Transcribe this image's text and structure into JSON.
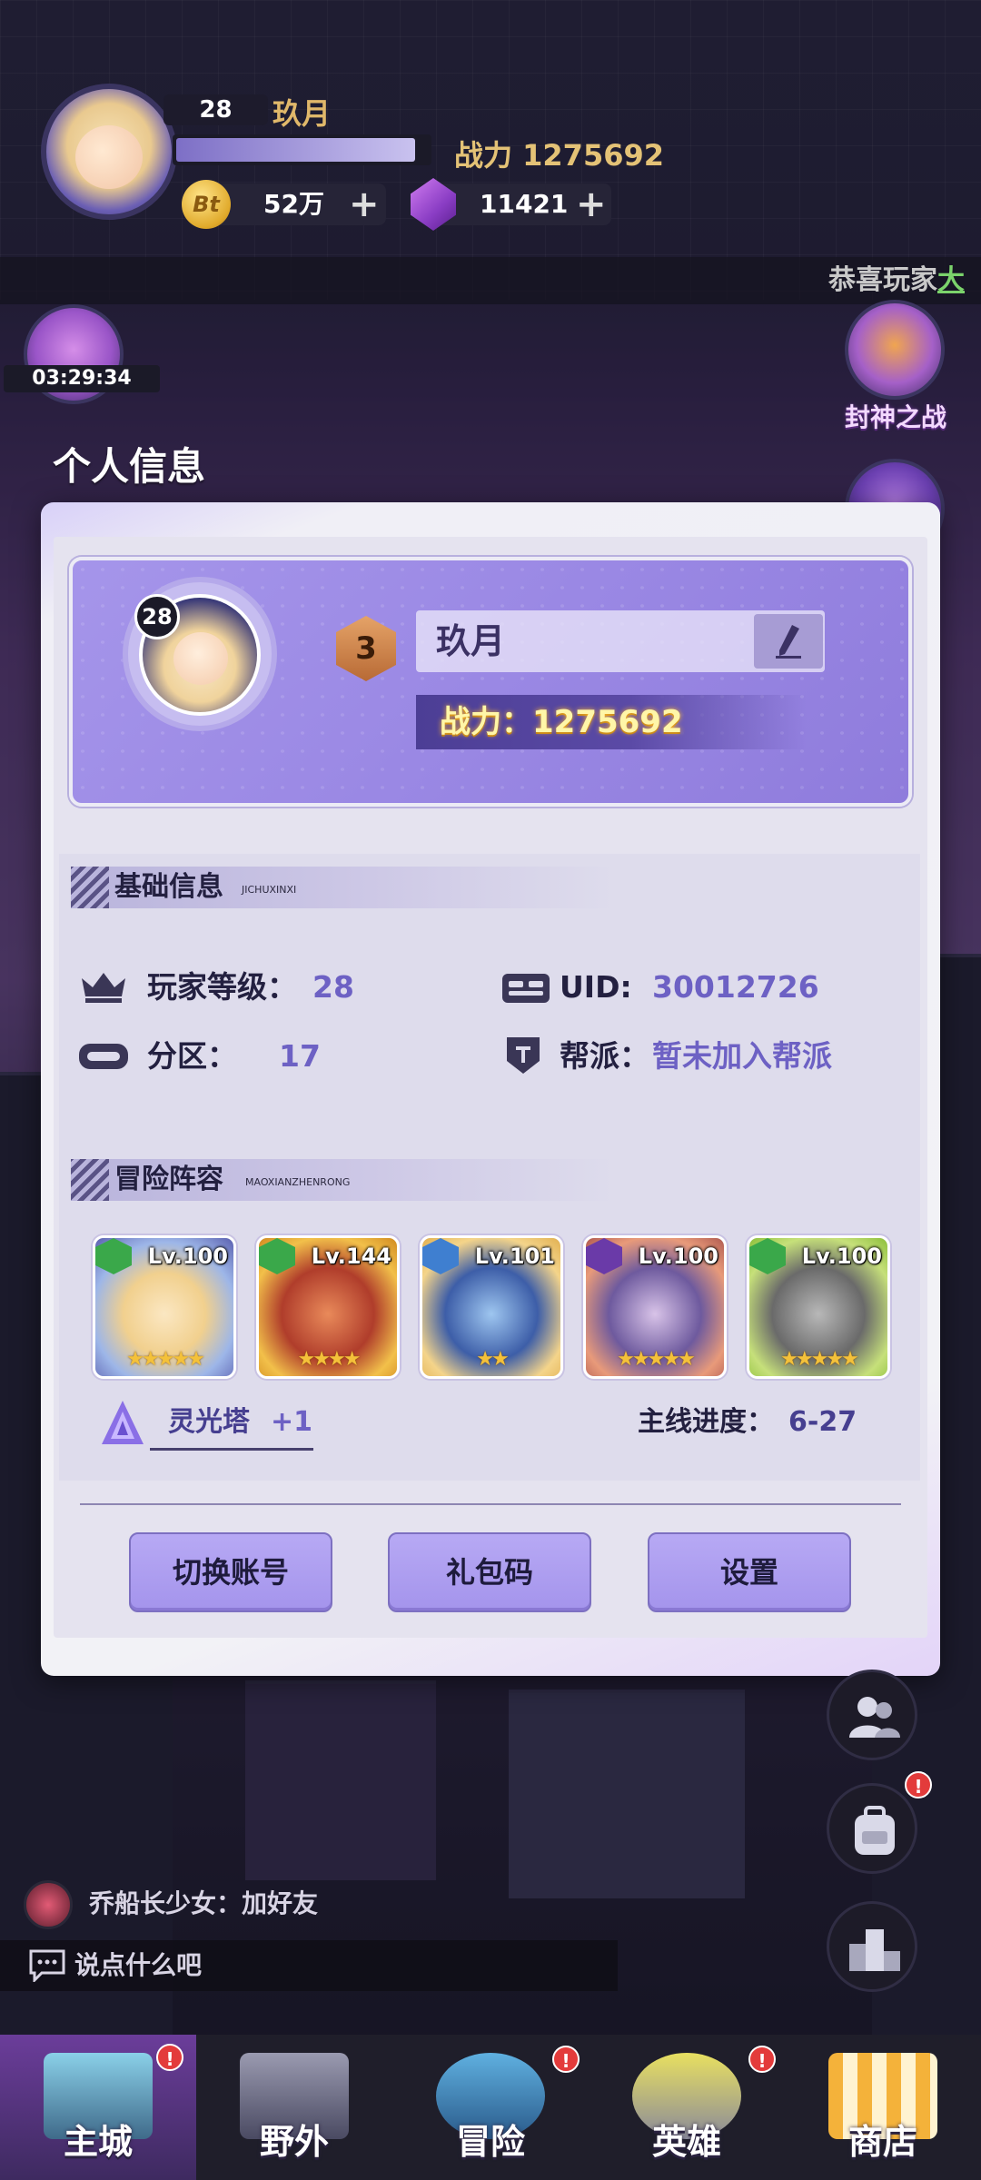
{
  "hud": {
    "level": "28",
    "name": "玖月",
    "exp_fraction": 0.95,
    "power_label": "战力 1275692",
    "coins": "52万",
    "coin_symbol": "Bt",
    "gems": "11421",
    "plus": "+",
    "ticker_prefix": "恭喜玩家",
    "ticker_highlight": "大",
    "timer": "03:29:34",
    "event_label": "封神之战"
  },
  "modal": {
    "title": "个人信息",
    "profile": {
      "level": "28",
      "vip_rank": "3",
      "name": "玖月",
      "power": "战力：1275692"
    },
    "basic_section": {
      "title": "基础信息",
      "subtitle": "JICHUXINXI",
      "player_level_label": "玩家等级：",
      "player_level_value": "28",
      "uid_label": "UID:",
      "uid_value": "30012726",
      "zone_label": "分区：",
      "zone_value": "17",
      "guild_label": "帮派：",
      "guild_value": "暂未加入帮派"
    },
    "lineup_section": {
      "title": "冒险阵容",
      "subtitle": "MAOXIANZHENRONG",
      "heroes": [
        {
          "level": "Lv.100",
          "stars": 5,
          "element": "green"
        },
        {
          "level": "Lv.144",
          "stars": 4,
          "element": "green"
        },
        {
          "level": "Lv.101",
          "stars": 2,
          "element": "blue"
        },
        {
          "level": "Lv.100",
          "stars": 5,
          "element": "purple"
        },
        {
          "level": "Lv.100",
          "stars": 5,
          "element": "green"
        }
      ],
      "tower_label": "灵光塔",
      "tower_value": "+1",
      "progress_label": "主线进度：",
      "progress_value": "6-27"
    },
    "buttons": {
      "switch_account": "切换账号",
      "gift_code": "礼包码",
      "settings": "设置"
    }
  },
  "chat": {
    "message": "乔船长少女：加好友",
    "input_placeholder": "说点什么吧"
  },
  "nav": {
    "items": [
      "主城",
      "野外",
      "冒险",
      "英雄",
      "商店"
    ],
    "active": "主城"
  },
  "colors": {
    "accent": "#6d61c4",
    "card": "#9a88e4",
    "button": "#a494ec",
    "badge": "#e33b3b"
  }
}
